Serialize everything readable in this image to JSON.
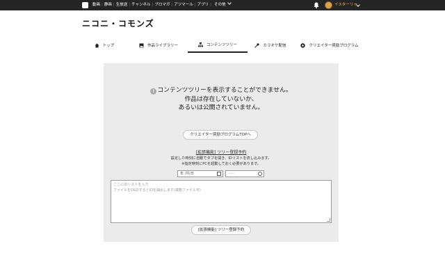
{
  "topbar": {
    "nav": [
      "動画",
      "静画",
      "生放送",
      "チャンネル",
      "ブロマガ",
      "アツマール",
      "アプリ",
      "その他"
    ],
    "username": "イスターリャ"
  },
  "brand": {
    "logo_text": "ニコニ・コモンズ"
  },
  "tabs": [
    {
      "label": "トップ",
      "icon": "home-icon"
    },
    {
      "label": "作品ライブラリー",
      "icon": "image-icon"
    },
    {
      "label": "コンテンツツリー",
      "icon": "tree-icon"
    },
    {
      "label": "カラオケ配信",
      "icon": "microphone-icon"
    },
    {
      "label": "クリエイター奨励プログラム",
      "icon": "badge-icon"
    }
  ],
  "message": {
    "line1": "コンテンツツリーを表示することができません。",
    "line2": "作品は存在していないか、",
    "line3": "あるいは公開されていません。"
  },
  "creator_top_button": "クリエイター奨励プログラムTOPへ",
  "extension": {
    "link": "[拡張機能] ツリー登録予約",
    "desc1": "設定した時刻に自動でタブを開き、IDリストを流し込みます。",
    "desc2": "※指定時刻にPCを起動しておく必要があります。",
    "date_value": "年 /月/日",
    "time_placeholder": "--:--",
    "textarea_placeholder1": "ここにIDリストを入力",
    "textarea_placeholder2": "ファイルをD&DするとIDを抽出します(複数ファイル可)",
    "submit_button": "[拡張機能] ツリー登録予約"
  }
}
